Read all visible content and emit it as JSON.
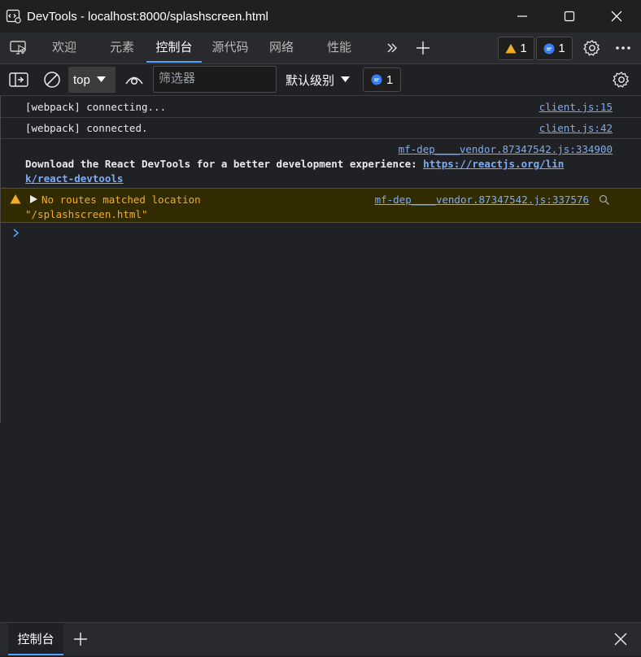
{
  "window": {
    "title": "DevTools - localhost:8000/splashscreen.html"
  },
  "tabs": [
    {
      "label": "欢迎"
    },
    {
      "label": "元素"
    },
    {
      "label": "控制台"
    },
    {
      "label": "源代码"
    },
    {
      "label": "网络"
    },
    {
      "label": "性能"
    }
  ],
  "counts": {
    "warnings": "1",
    "messages": "1",
    "toolbar_messages": "1"
  },
  "toolbar": {
    "context": "top",
    "filter_placeholder": "筛选器",
    "level": "默认级别"
  },
  "console": {
    "lines": [
      {
        "text": "[webpack] connecting...",
        "source": "client.js:15"
      },
      {
        "text": "[webpack] connected.",
        "source": "client.js:42"
      },
      {
        "text": "Download the React DevTools for a better development experience: ",
        "link_part1": "https://reactjs.org/lin",
        "link_part2": "k/react-devtools",
        "source": "mf-dep____vendor.87347542.js:334900"
      },
      {
        "text": "No routes matched location",
        "text2": "\"/splashscreen.html\"",
        "source": "mf-dep____vendor.87347542.js:337576"
      }
    ],
    "prompt": ">"
  },
  "drawer": {
    "tab": "控制台"
  },
  "colors": {
    "accent": "#4fa3ff",
    "warning": "#f2ab26",
    "link": "#7cacf8"
  }
}
